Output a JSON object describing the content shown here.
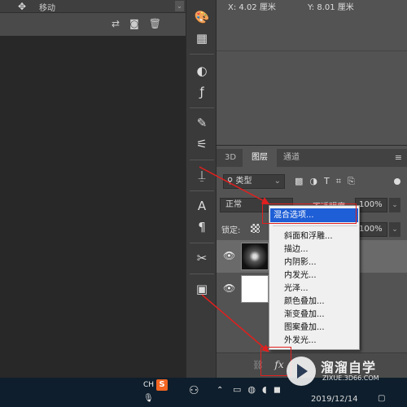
{
  "toolbar": {
    "tool_name": "移动",
    "move_icon": "move-icon"
  },
  "info": {
    "x_readout": "X:  4.02 厘米",
    "y_readout": "Y:  8.01 厘米"
  },
  "tabs": {
    "t3d": "3D",
    "layers": "图层",
    "channels": "通道",
    "menu": "≡"
  },
  "filter": {
    "kind_label": "类型"
  },
  "blend": {
    "mode": "正常",
    "opacity_label": "不透明度:",
    "opacity_value": "100%"
  },
  "lock": {
    "label": "锁定:",
    "fill_value": "100%"
  },
  "fx_button": "fx",
  "fx_menu": {
    "items": [
      "混合选项...",
      "斜面和浮雕...",
      "描边...",
      "内阴影...",
      "内发光...",
      "光泽...",
      "颜色叠加...",
      "渐变叠加...",
      "图案叠加...",
      "外发光..."
    ]
  },
  "taskbar": {
    "ime": "CH",
    "ime_logo": "S",
    "date": "2019/12/14"
  },
  "watermark": {
    "title": "溜溜自学",
    "url": "ZIXUE.3D66.COM"
  },
  "colors": {
    "annotation_red": "#e0201e",
    "menu_highlight": "#1e5ed6",
    "panel_bg": "#535353"
  }
}
